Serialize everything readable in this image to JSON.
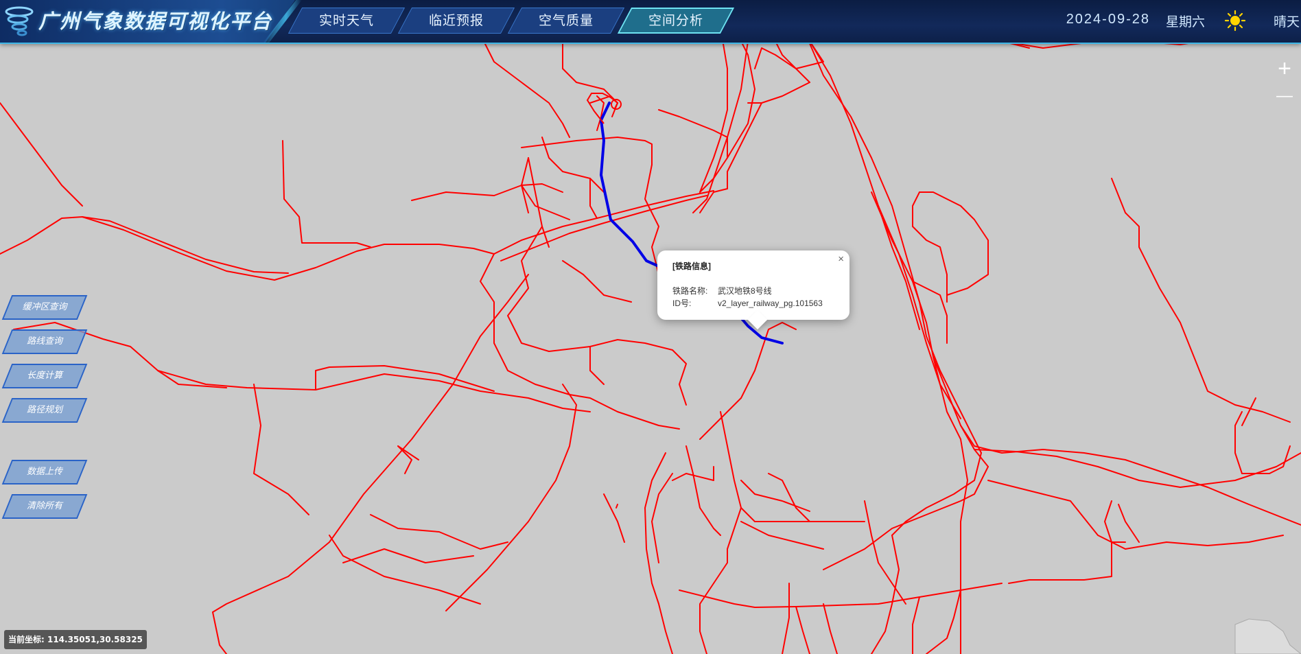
{
  "header": {
    "title": "广州气象数据可视化平台",
    "tabs": [
      {
        "label": "实时天气",
        "active": false
      },
      {
        "label": "临近预报",
        "active": false
      },
      {
        "label": "空气质量",
        "active": false
      },
      {
        "label": "空间分析",
        "active": true
      }
    ],
    "date": "2024-09-28",
    "weekday": "星期六",
    "weather_icon": "sun-icon",
    "weather": "晴天"
  },
  "zoom": {
    "in_label": "+",
    "out_label": "—"
  },
  "tools": {
    "buffer_query": "缓冲区查询",
    "route_query": "路线查询",
    "length_calc": "长度计算",
    "path_plan": "路径规划",
    "data_upload": "数据上传",
    "clear_all": "清除所有"
  },
  "popup": {
    "title": "[铁路信息]",
    "close": "×",
    "name_label": "铁路名称:",
    "name_value": "武汉地铁8号线",
    "id_label": "ID号:",
    "id_value": "v2_layer_railway_pg.101563"
  },
  "status": {
    "coordinates": "当前坐标: 114.35051,30.58325"
  },
  "colors": {
    "railway": "#ff0000",
    "selected_line": "#0000e6",
    "map_background": "#cbcbcb",
    "header_background": "#12295a",
    "header_accent": "#3fb6e6"
  }
}
